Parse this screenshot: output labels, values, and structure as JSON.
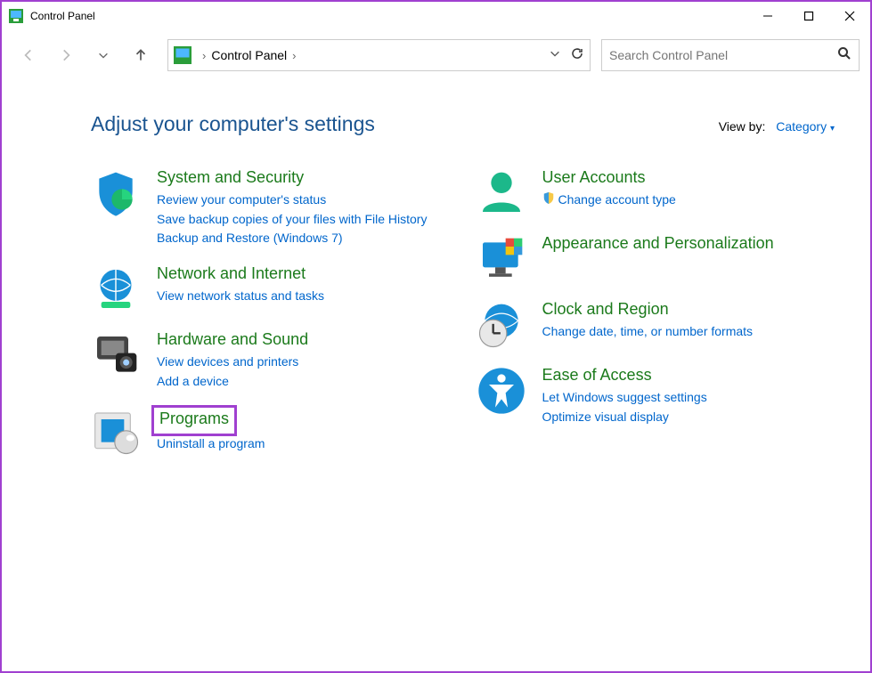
{
  "window": {
    "title": "Control Panel"
  },
  "breadcrumb": {
    "root": "Control Panel"
  },
  "search": {
    "placeholder": "Search Control Panel"
  },
  "header": {
    "title": "Adjust your computer's settings",
    "viewby_label": "View by:",
    "viewby_value": "Category"
  },
  "categories": {
    "left": [
      {
        "title": "System and Security",
        "links": [
          "Review your computer's status",
          "Save backup copies of your files with File History",
          "Backup and Restore (Windows 7)"
        ]
      },
      {
        "title": "Network and Internet",
        "links": [
          "View network status and tasks"
        ]
      },
      {
        "title": "Hardware and Sound",
        "links": [
          "View devices and printers",
          "Add a device"
        ]
      },
      {
        "title": "Programs",
        "links": [
          "Uninstall a program"
        ],
        "highlighted": true
      }
    ],
    "right": [
      {
        "title": "User Accounts",
        "links": [
          "Change account type"
        ],
        "shield_on_first": true
      },
      {
        "title": "Appearance and Personalization",
        "links": []
      },
      {
        "title": "Clock and Region",
        "links": [
          "Change date, time, or number formats"
        ]
      },
      {
        "title": "Ease of Access",
        "links": [
          "Let Windows suggest settings",
          "Optimize visual display"
        ]
      }
    ]
  }
}
